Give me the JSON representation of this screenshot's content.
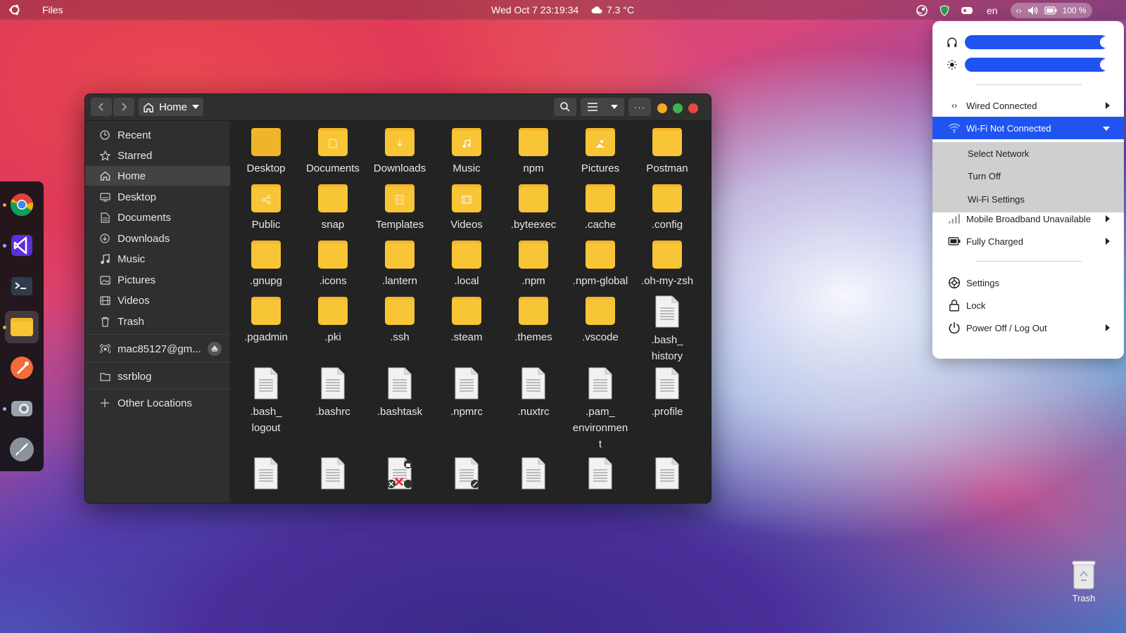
{
  "topbar": {
    "app_name": "Files",
    "clock": "Wed Oct 7  23:19:34",
    "weather": "7.3 °C",
    "lang": "en",
    "battery": "100 %"
  },
  "dock": {
    "apps": [
      "chrome-icon",
      "vscode-icon",
      "terminal-icon",
      "files-icon",
      "postman-icon",
      "screenshot-icon",
      "launcher-icon"
    ]
  },
  "window": {
    "path_label": "Home",
    "sidebar": {
      "recent": "Recent",
      "starred": "Starred",
      "home": "Home",
      "desktop": "Desktop",
      "documents": "Documents",
      "downloads": "Downloads",
      "music": "Music",
      "pictures": "Pictures",
      "videos": "Videos",
      "trash": "Trash",
      "account": "mac85127@gm...",
      "ssrblog": "ssrblog",
      "other": "Other Locations"
    },
    "files": {
      "f0": "Desktop",
      "f1": "Documents",
      "f2": "Downloads",
      "f3": "Music",
      "f4": "npm",
      "f5": "Pictures",
      "f6": "Postman",
      "f7": "Public",
      "f8": "snap",
      "f9": "Templates",
      "f10": "Videos",
      "f11": ".byteexec",
      "f12": ".cache",
      "f13": ".config",
      "f14": ".gnupg",
      "f15": ".icons",
      "f16": ".lantern",
      "f17": ".local",
      "f18": ".npm",
      "f19": ".npm-global",
      "f20": ".oh-my-zsh",
      "f21": ".pgadmin",
      "f22": ".pki",
      "f23": ".ssh",
      "f24": ".steam",
      "f25": ".themes",
      "f26": ".vscode",
      "f27": ".bash_\nhistory",
      "f28": ".bash_\nlogout",
      "f29": ".bashrc",
      "f30": ".bashtask",
      "f31": ".npmrc",
      "f32": ".nuxtrc",
      "f33": ".pam_\nenvironmen\nt",
      "f34": ".profile"
    }
  },
  "popover": {
    "wired": "Wired Connected",
    "wifi": "Wi-Fi Not Connected",
    "select_network": "Select Network",
    "turn_off": "Turn Off",
    "wifi_settings": "Wi-Fi Settings",
    "mobile": "Mobile Broadband Unavailable",
    "battery": "Fully Charged",
    "settings": "Settings",
    "lock": "Lock",
    "power": "Power Off / Log Out",
    "volume_level": 1.0,
    "brightness_level": 1.0
  },
  "desktop_trash": "Trash",
  "colors": {
    "accent": "#2054f0",
    "folder": "#f8c536"
  }
}
